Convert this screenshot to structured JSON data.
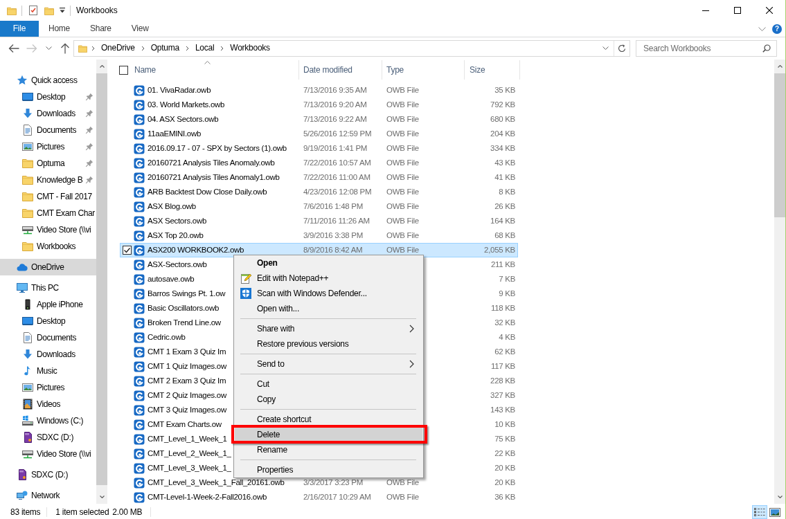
{
  "window": {
    "title": "Workbooks"
  },
  "ribbon": {
    "tabs": [
      {
        "label": "File",
        "kind": "file",
        "selected": false
      },
      {
        "label": "Home",
        "kind": "tab",
        "selected": false
      },
      {
        "label": "Share",
        "kind": "tab",
        "selected": false
      },
      {
        "label": "View",
        "kind": "tab",
        "selected": false
      }
    ],
    "help": "?"
  },
  "navigation": {
    "back_disabled": false,
    "forward_disabled": true
  },
  "address": {
    "crumbs": [
      "OneDrive",
      "Optuma",
      "Local",
      "Workbooks"
    ]
  },
  "search": {
    "placeholder": "Search Workbooks"
  },
  "sidebar": {
    "items": [
      {
        "label": "Quick access",
        "kind": "star",
        "selected": false,
        "pinned": false,
        "children": [
          {
            "label": "Desktop",
            "kind": "desktop",
            "selected": false,
            "pinned": true
          },
          {
            "label": "Downloads",
            "kind": "downloads",
            "selected": false,
            "pinned": true
          },
          {
            "label": "Documents",
            "kind": "documents",
            "selected": false,
            "pinned": true
          },
          {
            "label": "Pictures",
            "kind": "pictures",
            "selected": false,
            "pinned": true
          },
          {
            "label": "Optuma",
            "kind": "folder",
            "selected": false,
            "pinned": true
          },
          {
            "label": "Knowledge B",
            "kind": "folder",
            "selected": false,
            "pinned": true
          },
          {
            "label": "CMT - Fall 2017",
            "kind": "folder",
            "selected": false,
            "pinned": false
          },
          {
            "label": "CMT Exam Char",
            "kind": "folder",
            "selected": false,
            "pinned": false
          },
          {
            "label": "Video Store (\\\\vi",
            "kind": "network-drive",
            "selected": false,
            "pinned": false
          },
          {
            "label": "Workbooks",
            "kind": "folder",
            "selected": false,
            "pinned": false
          }
        ]
      },
      {
        "label": "OneDrive",
        "kind": "cloud",
        "selected": true,
        "pinned": false
      },
      {
        "label": "This PC",
        "kind": "computer",
        "selected": false,
        "pinned": false,
        "children": [
          {
            "label": "Apple iPhone",
            "kind": "phone",
            "selected": false,
            "pinned": false
          },
          {
            "label": "Desktop",
            "kind": "desktop",
            "selected": false,
            "pinned": false
          },
          {
            "label": "Documents",
            "kind": "documents",
            "selected": false,
            "pinned": false
          },
          {
            "label": "Downloads",
            "kind": "downloads",
            "selected": false,
            "pinned": false
          },
          {
            "label": "Music",
            "kind": "music",
            "selected": false,
            "pinned": false
          },
          {
            "label": "Pictures",
            "kind": "pictures",
            "selected": false,
            "pinned": false
          },
          {
            "label": "Videos",
            "kind": "videos",
            "selected": false,
            "pinned": false
          },
          {
            "label": "Windows (C:)",
            "kind": "system-drive",
            "selected": false,
            "pinned": false
          },
          {
            "label": "SDXC (D:)",
            "kind": "sd-card",
            "selected": false,
            "pinned": false
          },
          {
            "label": "Video Store (\\\\vi",
            "kind": "network-drive",
            "selected": false,
            "pinned": false
          }
        ]
      },
      {
        "label": "SDXC (D:)",
        "kind": "sd-card",
        "selected": false,
        "pinned": false
      },
      {
        "label": "Network",
        "kind": "network",
        "selected": false,
        "pinned": false
      }
    ]
  },
  "file_list": {
    "select_all_checked": false,
    "columns": [
      {
        "label": "Name",
        "sorted": true
      },
      {
        "label": "Date modified",
        "sorted": false
      },
      {
        "label": "Type",
        "sorted": false
      },
      {
        "label": "Size",
        "sorted": false
      }
    ],
    "rows": [
      {
        "name": "01. VivaRadar.owb",
        "date": "7/13/2016 9:35 AM",
        "type": "OWB File",
        "size": "35 KB",
        "selected": false
      },
      {
        "name": "03. World Markets.owb",
        "date": "7/13/2016 9:20 AM",
        "type": "OWB File",
        "size": "792 KB",
        "selected": false
      },
      {
        "name": "04. ASX Sectors.owb",
        "date": "7/13/2016 9:22 AM",
        "type": "OWB File",
        "size": "680 KB",
        "selected": false
      },
      {
        "name": "11aaEMINI.owb",
        "date": "5/26/2016 12:59 PM",
        "type": "OWB File",
        "size": "204 KB",
        "selected": false
      },
      {
        "name": "2016.09.17 - 07 - SPX by Sectors (1).owb",
        "date": "9/19/2016 1:41 PM",
        "type": "OWB File",
        "size": "334 KB",
        "selected": false
      },
      {
        "name": "20160721 Analysis Tiles Anomaly.owb",
        "date": "7/22/2016 10:57 AM",
        "type": "OWB File",
        "size": "43 KB",
        "selected": false
      },
      {
        "name": "20160721 Analysis Tiles Anomaly1.owb",
        "date": "7/22/2016 11:00 AM",
        "type": "OWB File",
        "size": "41 KB",
        "selected": false
      },
      {
        "name": "ARB Backtest Dow Close Daily.owb",
        "date": "4/23/2016 12:08 PM",
        "type": "OWB File",
        "size": "8 KB",
        "selected": false
      },
      {
        "name": "ASX Blog.owb",
        "date": "7/6/2016 1:48 PM",
        "type": "OWB File",
        "size": "26 KB",
        "selected": false
      },
      {
        "name": "ASX Sectors.owb",
        "date": "7/11/2016 11:26 AM",
        "type": "OWB File",
        "size": "164 KB",
        "selected": false
      },
      {
        "name": "ASX Top 20.owb",
        "date": "3/9/2016 3:38 PM",
        "type": "OWB File",
        "size": "68 KB",
        "selected": false
      },
      {
        "name": "ASX200 WORKBOOK2.owb",
        "date": "8/9/2016 8:42 AM",
        "type": "OWB File",
        "size": "2,055 KB",
        "selected": true
      },
      {
        "name": "ASX-Sectors.owb",
        "size": "211 KB",
        "selected": false
      },
      {
        "name": "autosave.owb",
        "size": "7 KB",
        "selected": false
      },
      {
        "name": "Barros Swings Pt. 1.ow",
        "size": "9 KB",
        "selected": false
      },
      {
        "name": "Basic Oscillators.owb",
        "size": "118 KB",
        "selected": false
      },
      {
        "name": "Broken Trend Line.ow",
        "size": "32 KB",
        "selected": false
      },
      {
        "name": "Cedric.owb",
        "size": "4 KB",
        "selected": false
      },
      {
        "name": "CMT 1 Exam 3 Quiz Im",
        "size": "62 KB",
        "selected": false
      },
      {
        "name": "CMT 1 Quiz Images.ow",
        "size": "117 KB",
        "selected": false
      },
      {
        "name": "CMT 2 Exam 3 Quiz Im",
        "size": "228 KB",
        "selected": false
      },
      {
        "name": "CMT 2 Quiz Images.ow",
        "size": "327 KB",
        "selected": false
      },
      {
        "name": "CMT 3 Quiz Images.ow",
        "size": "143 KB",
        "selected": false
      },
      {
        "name": "CMT Exam Charts.ow",
        "size": "10 KB",
        "selected": false
      },
      {
        "name": "CMT_Level_1_Week_1",
        "size": "75 KB",
        "selected": false
      },
      {
        "name": "CMT_Level_2_Week_1_",
        "size": "22 KB",
        "selected": false
      },
      {
        "name": "CMT_Level_3_Week_1_",
        "size": "20 KB",
        "selected": false
      },
      {
        "name": "CMT_Level_3_Week_1_Fall_20161.owb",
        "date": "3/3/2017 3:23 PM",
        "type": "OWB File",
        "size": "20 KB",
        "selected": false
      },
      {
        "name": "CMT-Level-1-Week-2-Fall2016.owb",
        "date": "2/16/2017 10:29 AM",
        "type": "OWB File",
        "size": "36 KB",
        "selected": false
      }
    ]
  },
  "context_menu": {
    "items": [
      {
        "kind": "command",
        "label": "Open",
        "default": true,
        "selected": false,
        "outlined": false
      },
      {
        "kind": "notepad-command",
        "label": "Edit with Notepad++",
        "default": false,
        "selected": false,
        "outlined": false
      },
      {
        "kind": "shield-command",
        "label": "Scan with Windows Defender...",
        "default": false,
        "selected": false,
        "outlined": false
      },
      {
        "kind": "command",
        "label": "Open with...",
        "default": false,
        "selected": false,
        "outlined": false
      },
      {
        "kind": "separator"
      },
      {
        "kind": "submenu",
        "label": "Share with",
        "default": false,
        "selected": false,
        "outlined": false
      },
      {
        "kind": "command",
        "label": "Restore previous versions",
        "default": false,
        "selected": false,
        "outlined": false
      },
      {
        "kind": "separator"
      },
      {
        "kind": "submenu",
        "label": "Send to",
        "default": false,
        "selected": false,
        "outlined": false
      },
      {
        "kind": "separator"
      },
      {
        "kind": "command",
        "label": "Cut",
        "default": false,
        "selected": false,
        "outlined": false
      },
      {
        "kind": "command",
        "label": "Copy",
        "default": false,
        "selected": false,
        "outlined": false
      },
      {
        "kind": "separator"
      },
      {
        "kind": "command",
        "label": "Create shortcut",
        "default": false,
        "selected": false,
        "outlined": false
      },
      {
        "kind": "command",
        "label": "Delete",
        "default": false,
        "selected": true,
        "outlined": true
      },
      {
        "kind": "command",
        "label": "Rename",
        "default": false,
        "selected": false,
        "outlined": false
      },
      {
        "kind": "separator"
      },
      {
        "kind": "command",
        "label": "Properties",
        "default": false,
        "selected": false,
        "outlined": false
      }
    ]
  },
  "status_bar": {
    "item_count": "83 items",
    "selection": "1 item selected",
    "selection_size": "2.00 MB",
    "views": [
      {
        "kind": "details",
        "selected": true
      },
      {
        "kind": "large-icons",
        "selected": false
      }
    ]
  }
}
